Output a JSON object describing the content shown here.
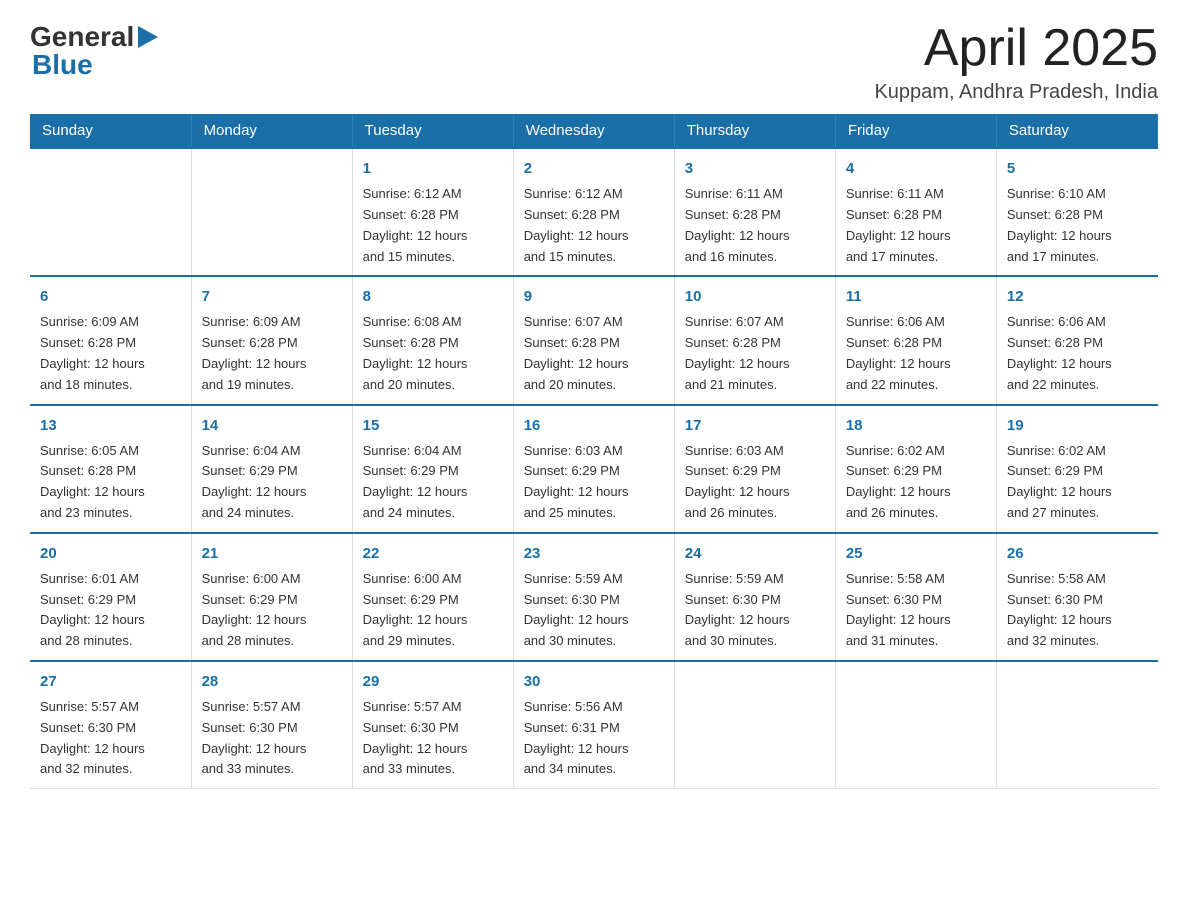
{
  "header": {
    "logo": {
      "general": "General",
      "blue": "Blue"
    },
    "title": "April 2025",
    "location": "Kuppam, Andhra Pradesh, India"
  },
  "calendar": {
    "days_of_week": [
      "Sunday",
      "Monday",
      "Tuesday",
      "Wednesday",
      "Thursday",
      "Friday",
      "Saturday"
    ],
    "weeks": [
      [
        {
          "day": "",
          "info": ""
        },
        {
          "day": "",
          "info": ""
        },
        {
          "day": "1",
          "info": "Sunrise: 6:12 AM\nSunset: 6:28 PM\nDaylight: 12 hours\nand 15 minutes."
        },
        {
          "day": "2",
          "info": "Sunrise: 6:12 AM\nSunset: 6:28 PM\nDaylight: 12 hours\nand 15 minutes."
        },
        {
          "day": "3",
          "info": "Sunrise: 6:11 AM\nSunset: 6:28 PM\nDaylight: 12 hours\nand 16 minutes."
        },
        {
          "day": "4",
          "info": "Sunrise: 6:11 AM\nSunset: 6:28 PM\nDaylight: 12 hours\nand 17 minutes."
        },
        {
          "day": "5",
          "info": "Sunrise: 6:10 AM\nSunset: 6:28 PM\nDaylight: 12 hours\nand 17 minutes."
        }
      ],
      [
        {
          "day": "6",
          "info": "Sunrise: 6:09 AM\nSunset: 6:28 PM\nDaylight: 12 hours\nand 18 minutes."
        },
        {
          "day": "7",
          "info": "Sunrise: 6:09 AM\nSunset: 6:28 PM\nDaylight: 12 hours\nand 19 minutes."
        },
        {
          "day": "8",
          "info": "Sunrise: 6:08 AM\nSunset: 6:28 PM\nDaylight: 12 hours\nand 20 minutes."
        },
        {
          "day": "9",
          "info": "Sunrise: 6:07 AM\nSunset: 6:28 PM\nDaylight: 12 hours\nand 20 minutes."
        },
        {
          "day": "10",
          "info": "Sunrise: 6:07 AM\nSunset: 6:28 PM\nDaylight: 12 hours\nand 21 minutes."
        },
        {
          "day": "11",
          "info": "Sunrise: 6:06 AM\nSunset: 6:28 PM\nDaylight: 12 hours\nand 22 minutes."
        },
        {
          "day": "12",
          "info": "Sunrise: 6:06 AM\nSunset: 6:28 PM\nDaylight: 12 hours\nand 22 minutes."
        }
      ],
      [
        {
          "day": "13",
          "info": "Sunrise: 6:05 AM\nSunset: 6:28 PM\nDaylight: 12 hours\nand 23 minutes."
        },
        {
          "day": "14",
          "info": "Sunrise: 6:04 AM\nSunset: 6:29 PM\nDaylight: 12 hours\nand 24 minutes."
        },
        {
          "day": "15",
          "info": "Sunrise: 6:04 AM\nSunset: 6:29 PM\nDaylight: 12 hours\nand 24 minutes."
        },
        {
          "day": "16",
          "info": "Sunrise: 6:03 AM\nSunset: 6:29 PM\nDaylight: 12 hours\nand 25 minutes."
        },
        {
          "day": "17",
          "info": "Sunrise: 6:03 AM\nSunset: 6:29 PM\nDaylight: 12 hours\nand 26 minutes."
        },
        {
          "day": "18",
          "info": "Sunrise: 6:02 AM\nSunset: 6:29 PM\nDaylight: 12 hours\nand 26 minutes."
        },
        {
          "day": "19",
          "info": "Sunrise: 6:02 AM\nSunset: 6:29 PM\nDaylight: 12 hours\nand 27 minutes."
        }
      ],
      [
        {
          "day": "20",
          "info": "Sunrise: 6:01 AM\nSunset: 6:29 PM\nDaylight: 12 hours\nand 28 minutes."
        },
        {
          "day": "21",
          "info": "Sunrise: 6:00 AM\nSunset: 6:29 PM\nDaylight: 12 hours\nand 28 minutes."
        },
        {
          "day": "22",
          "info": "Sunrise: 6:00 AM\nSunset: 6:29 PM\nDaylight: 12 hours\nand 29 minutes."
        },
        {
          "day": "23",
          "info": "Sunrise: 5:59 AM\nSunset: 6:30 PM\nDaylight: 12 hours\nand 30 minutes."
        },
        {
          "day": "24",
          "info": "Sunrise: 5:59 AM\nSunset: 6:30 PM\nDaylight: 12 hours\nand 30 minutes."
        },
        {
          "day": "25",
          "info": "Sunrise: 5:58 AM\nSunset: 6:30 PM\nDaylight: 12 hours\nand 31 minutes."
        },
        {
          "day": "26",
          "info": "Sunrise: 5:58 AM\nSunset: 6:30 PM\nDaylight: 12 hours\nand 32 minutes."
        }
      ],
      [
        {
          "day": "27",
          "info": "Sunrise: 5:57 AM\nSunset: 6:30 PM\nDaylight: 12 hours\nand 32 minutes."
        },
        {
          "day": "28",
          "info": "Sunrise: 5:57 AM\nSunset: 6:30 PM\nDaylight: 12 hours\nand 33 minutes."
        },
        {
          "day": "29",
          "info": "Sunrise: 5:57 AM\nSunset: 6:30 PM\nDaylight: 12 hours\nand 33 minutes."
        },
        {
          "day": "30",
          "info": "Sunrise: 5:56 AM\nSunset: 6:31 PM\nDaylight: 12 hours\nand 34 minutes."
        },
        {
          "day": "",
          "info": ""
        },
        {
          "day": "",
          "info": ""
        },
        {
          "day": "",
          "info": ""
        }
      ]
    ]
  }
}
